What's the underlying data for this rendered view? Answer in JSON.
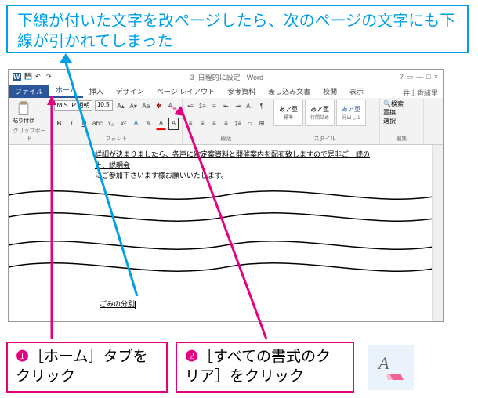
{
  "callout_top": "下線が付いた文字を改ページしたら、次のページの文字にも下線が引かれてしまった",
  "word": {
    "docname": "3_日程的に設定 - Word",
    "username": "井上香緒里",
    "tabs": {
      "file": "ファイル",
      "home": "ホーム",
      "insert": "挿入",
      "design": "デザイン",
      "layout": "ページ レイアウト",
      "references": "参考資料",
      "mailings": "差し込み文書",
      "review": "校閲",
      "view": "表示"
    },
    "ribbon": {
      "paste": "貼り付け",
      "clipboard": "クリップボード",
      "font_name": "ＭＳ Ｐ明朝",
      "font_size": "10.5",
      "font_label": "フォント",
      "para_label": "段落",
      "style1_top": "あア亜",
      "style1_bottom": "標準",
      "style2_top": "あア亜",
      "style2_bottom": "行間詰め",
      "style3_top": "あア亜",
      "style3_bottom": "見出し 1",
      "style_label": "スタイル",
      "find": "検索",
      "replace": "置換",
      "select": "選択",
      "editing": "編集"
    },
    "doc_line1": "詳細が決まりましたら、各戸に欧定案資料と開催案内を配布致しますので是非ご一読の上、",
    "doc_link": "説明会",
    "doc_line2": "にご参加下さいます様お願いいたします。",
    "page2_text": "ごみの分別"
  },
  "callouts": {
    "num1": "❶",
    "c1_text": "［ホーム］タブをクリック",
    "num2": "❷",
    "c2_text": "［すべての書式のクリア］をクリック"
  }
}
